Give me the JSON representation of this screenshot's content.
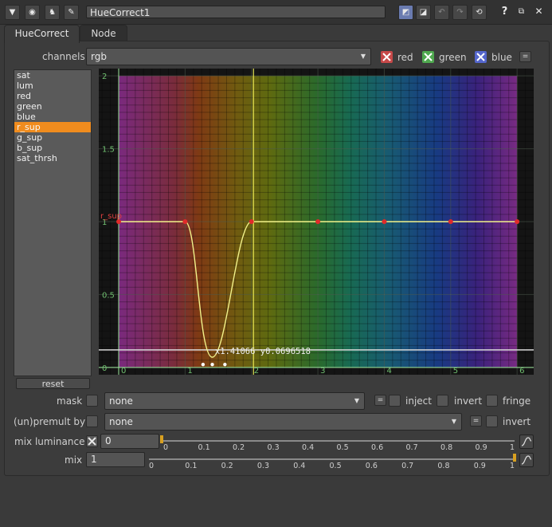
{
  "toolbar": {
    "node_name": "HueCorrect1",
    "help_label": "?",
    "icons": [
      "collapse-arrow-icon",
      "circle-icon",
      "cow-icon",
      "wrench-icon",
      "float-icon",
      "color-swatch-icon",
      "undo-icon",
      "redo-icon",
      "revert-icon",
      "help-icon",
      "float-window-icon",
      "close-icon"
    ]
  },
  "tabs": [
    {
      "label": "HueCorrect",
      "active": true
    },
    {
      "label": "Node",
      "active": false
    }
  ],
  "channels": {
    "label": "channels",
    "value": "rgb",
    "checks": [
      {
        "label": "red",
        "checked": true,
        "color": "#e04848"
      },
      {
        "label": "green",
        "checked": true,
        "color": "#4db84d"
      },
      {
        "label": "blue",
        "checked": true,
        "color": "#5a6ee0"
      }
    ],
    "eq_label": "="
  },
  "curves": {
    "items": [
      "sat",
      "lum",
      "red",
      "green",
      "blue",
      "r_sup",
      "g_sup",
      "b_sup",
      "sat_thrsh"
    ],
    "selected": "r_sup",
    "reset_label": "reset"
  },
  "graph": {
    "y_ticks": [
      "0",
      "0.5",
      "1",
      "1.5",
      "2"
    ],
    "x_ticks": [
      "0",
      "1",
      "2",
      "3",
      "4",
      "5",
      "6"
    ],
    "curve_label": "r_sup",
    "readout": "x1.41066 y0.0696518"
  },
  "chart_data": {
    "type": "line",
    "xlabel": "",
    "ylabel": "",
    "xlim": [
      -0.3,
      6.25
    ],
    "ylim": [
      -0.05,
      2.05
    ],
    "series": [
      {
        "points": [
          [
            0,
            1
          ],
          [
            1,
            1
          ],
          [
            2,
            1
          ],
          [
            3,
            1
          ],
          [
            4,
            1
          ],
          [
            5,
            1
          ],
          [
            6,
            1
          ]
        ]
      },
      {
        "points": [
          [
            1,
            1
          ],
          [
            1.41,
            0.07
          ],
          [
            2,
            1
          ]
        ]
      }
    ],
    "selected_keys": [
      [
        1.27,
        0.02
      ],
      [
        1.41,
        0.02
      ],
      [
        1.6,
        0.02
      ]
    ],
    "cursor_x": 2.03,
    "horizontal_guide_y": 0.12
  },
  "mask": {
    "label": "mask",
    "value": "none",
    "eq_label": "=",
    "inject_label": "inject",
    "invert_label": "invert",
    "fringe_label": "fringe"
  },
  "premult": {
    "label": "(un)premult by",
    "value": "none",
    "eq_label": "=",
    "invert_label": "invert"
  },
  "mix_luminance": {
    "label": "mix luminance",
    "value": "0",
    "ticks": [
      "0",
      "0.1",
      "0.2",
      "0.3",
      "0.4",
      "0.5",
      "0.6",
      "0.7",
      "0.8",
      "0.9",
      "1"
    ],
    "level": 0
  },
  "mix": {
    "label": "mix",
    "value": "1",
    "ticks": [
      "0",
      "0.1",
      "0.2",
      "0.3",
      "0.4",
      "0.5",
      "0.6",
      "0.7",
      "0.8",
      "0.9",
      "1"
    ],
    "level": 1
  }
}
